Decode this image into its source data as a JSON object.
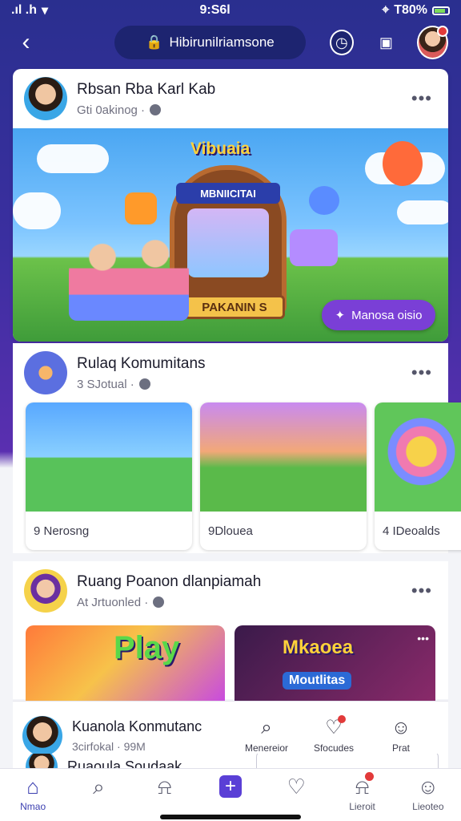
{
  "status_bar": {
    "signal": ".ıl .h",
    "time": "9:S6l",
    "battery": "T80%"
  },
  "top_bar": {
    "url": "Hibirunilriamsone"
  },
  "post": {
    "author": "Rbsan Rba Karl Kab",
    "subtitle": "Gti 0akinog ·",
    "banner_title": "Vibuaia",
    "banner_sign": "MBNIICITAI",
    "banner_base": "PAKANIN S",
    "cta_label": "Manosa oisio"
  },
  "community": {
    "title": "Rulaq Komumitans",
    "subtitle": "3 SJotual ·",
    "cards": [
      {
        "label": "9 Nerosng"
      },
      {
        "label": "9Dlouea"
      },
      {
        "label": "4 IDeoalds"
      }
    ]
  },
  "room": {
    "title": "Ruang Poanon dlanpiamah",
    "subtitle": "At Jrtuonled ·",
    "card1_text": "Play",
    "card2_text": "Mkaoea",
    "card2_sub": "Moutlitas"
  },
  "mini_bar": {
    "title": "Kuanola Konmutanc",
    "subtitle": "3cirfokal · 99M",
    "actions": [
      {
        "label": "Menereior"
      },
      {
        "label": "Sfocudes"
      },
      {
        "label": "Prat"
      }
    ]
  },
  "peek": {
    "title": "Ruaoula Soudaak"
  },
  "bottom_nav": [
    {
      "label": "Nmao"
    },
    {
      "label": ""
    },
    {
      "label": ""
    },
    {
      "label": ""
    },
    {
      "label": ""
    },
    {
      "label": "Lieroit"
    },
    {
      "label": "Lieoteo"
    }
  ],
  "colors": {
    "accent": "#5a3fd6",
    "brand_dark": "#1d2470",
    "notification": "#e23a3a"
  },
  "icons": [
    "back-icon",
    "lock-icon",
    "clock-icon",
    "camera-icon",
    "more-icon",
    "globe-icon",
    "search-icon",
    "heart-icon",
    "user-icon",
    "home-icon",
    "bell-icon",
    "plus-icon"
  ]
}
